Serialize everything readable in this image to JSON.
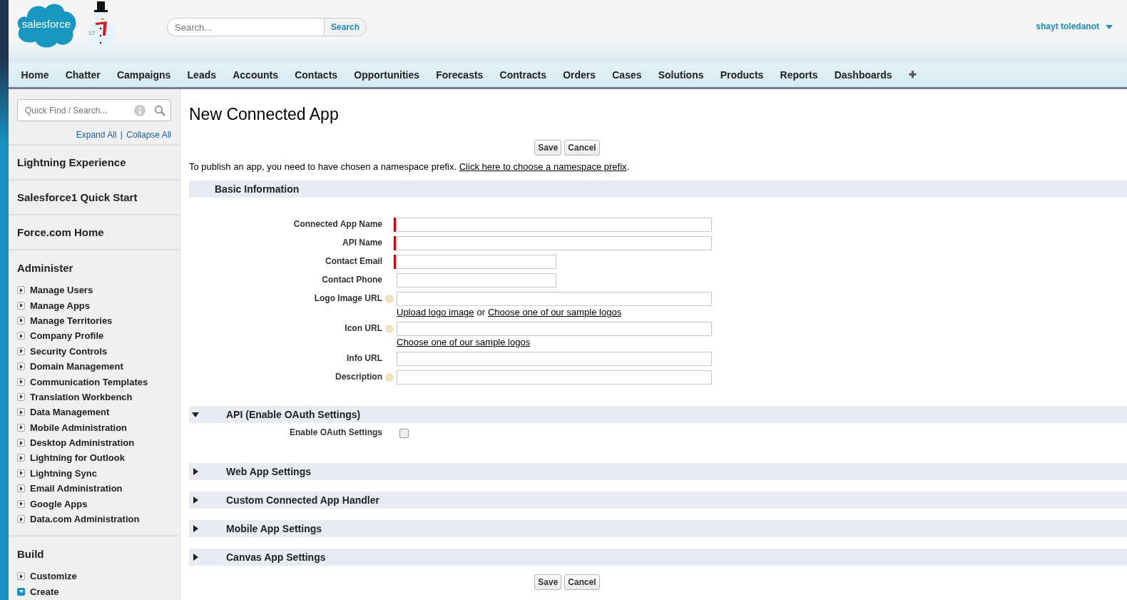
{
  "header": {
    "logo_text": "salesforce",
    "badge_text": "'17",
    "search": {
      "placeholder": "Search...",
      "button": "Search"
    },
    "user": "shayt toledanot"
  },
  "tabs": [
    {
      "label": "Home",
      "selected": false
    },
    {
      "label": "Chatter",
      "selected": false
    },
    {
      "label": "Campaigns",
      "selected": false
    },
    {
      "label": "Leads",
      "selected": false
    },
    {
      "label": "Accounts",
      "selected": false
    },
    {
      "label": "Contacts",
      "selected": false
    },
    {
      "label": "Opportunities",
      "selected": false
    },
    {
      "label": "Forecasts",
      "selected": false
    },
    {
      "label": "Contracts",
      "selected": false
    },
    {
      "label": "Orders",
      "selected": false
    },
    {
      "label": "Cases",
      "selected": false
    },
    {
      "label": "Solutions",
      "selected": false
    },
    {
      "label": "Products",
      "selected": false
    },
    {
      "label": "Reports",
      "selected": false
    },
    {
      "label": "Dashboards",
      "selected": false
    }
  ],
  "add_tab": "✚",
  "sidebar": {
    "quick_find": {
      "placeholder": "Quick Find / Search..."
    },
    "expand_all": "Expand All",
    "separator": "|",
    "collapse_all": "Collapse All",
    "links": [
      "Lightning Experience",
      "Salesforce1 Quick Start",
      "Force.com Home"
    ],
    "groups": [
      {
        "title": "Administer",
        "items": [
          {
            "label": "Manage Users",
            "expanded": false
          },
          {
            "label": "Manage Apps",
            "expanded": false
          },
          {
            "label": "Manage Territories",
            "expanded": false
          },
          {
            "label": "Company Profile",
            "expanded": false
          },
          {
            "label": "Security Controls",
            "expanded": false
          },
          {
            "label": "Domain Management",
            "expanded": false
          },
          {
            "label": "Communication Templates",
            "expanded": false
          },
          {
            "label": "Translation Workbench",
            "expanded": false
          },
          {
            "label": "Data Management",
            "expanded": false
          },
          {
            "label": "Mobile Administration",
            "expanded": false
          },
          {
            "label": "Desktop Administration",
            "expanded": false
          },
          {
            "label": "Lightning for Outlook",
            "expanded": false
          },
          {
            "label": "Lightning Sync",
            "expanded": false
          },
          {
            "label": "Email Administration",
            "expanded": false
          },
          {
            "label": "Google Apps",
            "expanded": false
          },
          {
            "label": "Data.com Administration",
            "expanded": false
          }
        ]
      },
      {
        "title": "Build",
        "items": [
          {
            "label": "Customize",
            "expanded": false
          },
          {
            "label": "Create",
            "expanded": true
          }
        ]
      }
    ]
  },
  "page": {
    "title": "New Connected App",
    "buttons": [
      "Save",
      "Cancel"
    ],
    "note": "To publish an app, you need to have chosen a namespace prefix.",
    "note_link": "Click here to choose a namespace prefix",
    "note_end": ".",
    "basic": {
      "title": "Basic Information",
      "fields": [
        {
          "label": "Connected App Name",
          "required": true,
          "help": false,
          "kind": "wide"
        },
        {
          "label": "API Name",
          "required": true,
          "help": false,
          "kind": "wide"
        },
        {
          "label": "Contact Email",
          "required": true,
          "help": false,
          "kind": "narrow"
        },
        {
          "label": "Contact Phone",
          "required": false,
          "help": false,
          "kind": "narrow"
        },
        {
          "label": "Logo Image URL",
          "required": false,
          "help": true,
          "kind": "wide",
          "below": [
            {
              "kind": "link",
              "text": "Upload logo image"
            },
            {
              "kind": "text",
              "text": "or"
            },
            {
              "kind": "link",
              "text": "Choose one of our sample logos"
            }
          ]
        },
        {
          "label": "Icon URL",
          "required": false,
          "help": true,
          "kind": "wide",
          "below": [
            {
              "kind": "link",
              "text": "Choose one of our sample logos"
            }
          ]
        },
        {
          "label": "Info URL",
          "required": false,
          "help": false,
          "kind": "wide"
        },
        {
          "label": "Description",
          "required": false,
          "help": true,
          "kind": "wide"
        }
      ]
    },
    "sections": [
      {
        "title": "API (Enable OAuth Settings)",
        "expanded": true,
        "checkbox": {
          "label": "Enable OAuth Settings",
          "checked": false
        }
      },
      {
        "title": "Web App Settings",
        "expanded": false
      },
      {
        "title": "Custom Connected App Handler",
        "expanded": false
      },
      {
        "title": "Mobile App Settings",
        "expanded": false
      },
      {
        "title": "Canvas App Settings",
        "expanded": false
      }
    ],
    "bottom_buttons": [
      "Save",
      "Cancel"
    ]
  }
}
